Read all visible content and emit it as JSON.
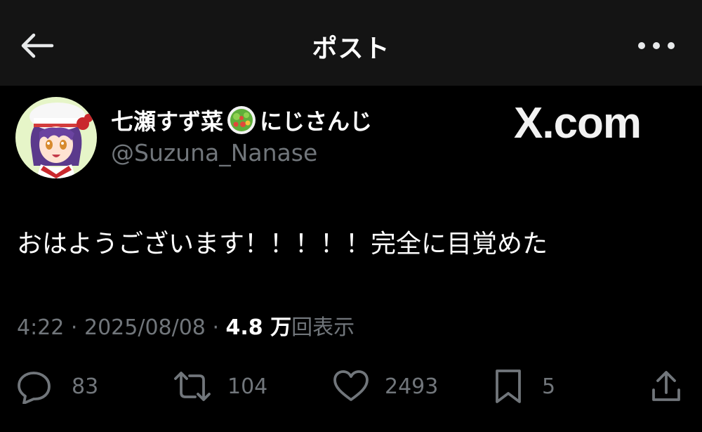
{
  "header": {
    "title": "ポスト",
    "back_icon": "arrow-left-icon",
    "more_icon": "more-dots-icon"
  },
  "author": {
    "display_name_before": "七瀬すず菜",
    "display_name_after": "にじさんじ",
    "emoji_icon": "salad-bowl-icon",
    "handle": "@Suzuna_Nanase"
  },
  "watermark": "X.com",
  "post": {
    "text": "おはようございます！！！！！完全に目覚めた"
  },
  "meta": {
    "time": "4:22",
    "sep1": " · ",
    "date": "2025/08/08",
    "sep2": " · ",
    "views_count": "4.8 万",
    "views_label": "回表示"
  },
  "actions": {
    "replies": "83",
    "reposts": "104",
    "likes": "2493",
    "bookmarks": "5"
  },
  "colors": {
    "background": "#000000",
    "header_bg": "#141414",
    "primary_text": "#ffffff",
    "secondary_text": "#71767b"
  }
}
